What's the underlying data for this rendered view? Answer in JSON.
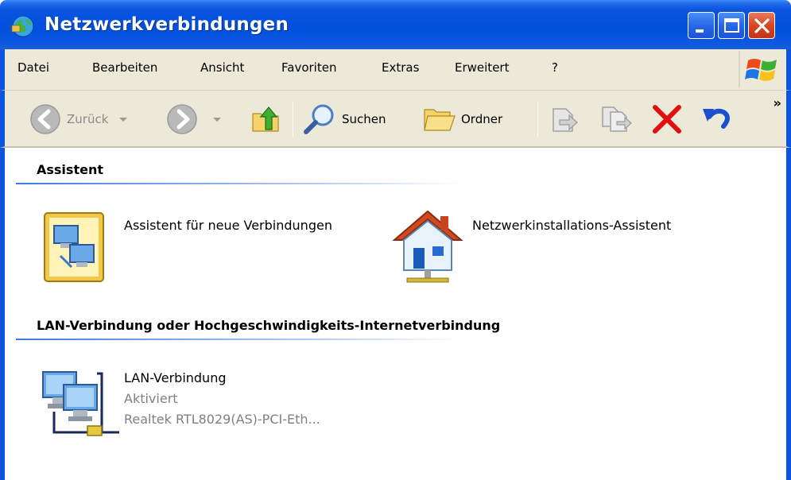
{
  "window": {
    "title": "Netzwerkverbindungen"
  },
  "menu": {
    "items": [
      "Datei",
      "Bearbeiten",
      "Ansicht",
      "Favoriten",
      "Extras",
      "Erweitert",
      "?"
    ]
  },
  "toolbar": {
    "back_label": "Zurück",
    "search_label": "Suchen",
    "folders_label": "Ordner",
    "more": "»"
  },
  "groups": [
    {
      "title": "Assistent",
      "items": [
        {
          "label": "Assistent für neue Verbindungen",
          "icon": "new-connection-wizard-icon"
        },
        {
          "label": "Netzwerkinstallations-Assistent",
          "icon": "network-setup-wizard-icon"
        }
      ]
    },
    {
      "title": "LAN-Verbindung oder Hochgeschwindigkeits-Internetverbindung",
      "items": [
        {
          "label": "LAN-Verbindung",
          "status": "Aktiviert",
          "device": "Realtek RTL8029(AS)-PCI-Eth...",
          "icon": "lan-connection-icon"
        }
      ]
    }
  ],
  "colors": {
    "titlebar": "#0a54e0",
    "chrome": "#ece9d8",
    "close_button": "#d6431f",
    "delete_red": "#e01010",
    "undo_blue": "#1a4fd0"
  }
}
